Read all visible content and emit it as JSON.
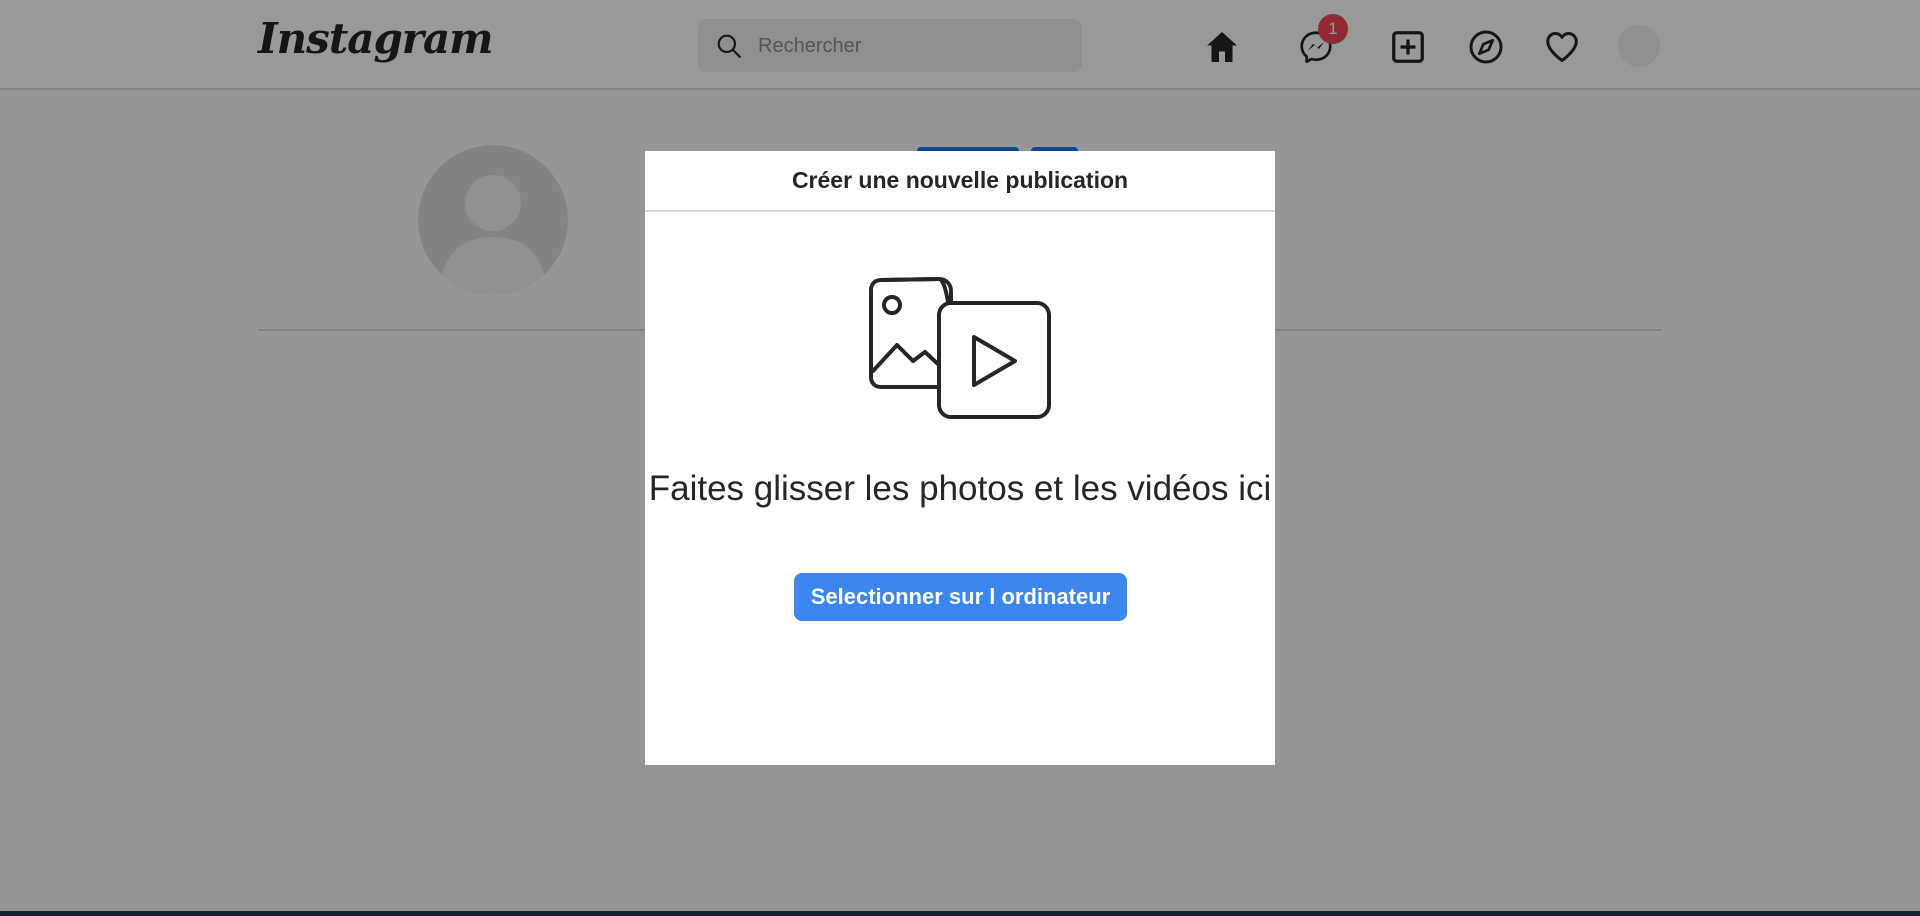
{
  "header": {
    "logo_text": "Instagram",
    "search": {
      "placeholder": "Rechercher"
    },
    "nav": {
      "messages_badge": "1",
      "icons": [
        "home-icon",
        "messenger-icon",
        "new-post-icon",
        "explore-icon",
        "activity-heart-icon",
        "profile-avatar"
      ]
    }
  },
  "modal": {
    "title": "Créer une nouvelle publication",
    "drag_text": "Faites glisser les photos et les vidéos ici",
    "select_button": "Selectionner sur l ordinateur"
  },
  "colors": {
    "button_blue": "#3c87ef",
    "badge_red": "#ed4956",
    "overlay": "rgba(0,0,0,0.4)"
  }
}
